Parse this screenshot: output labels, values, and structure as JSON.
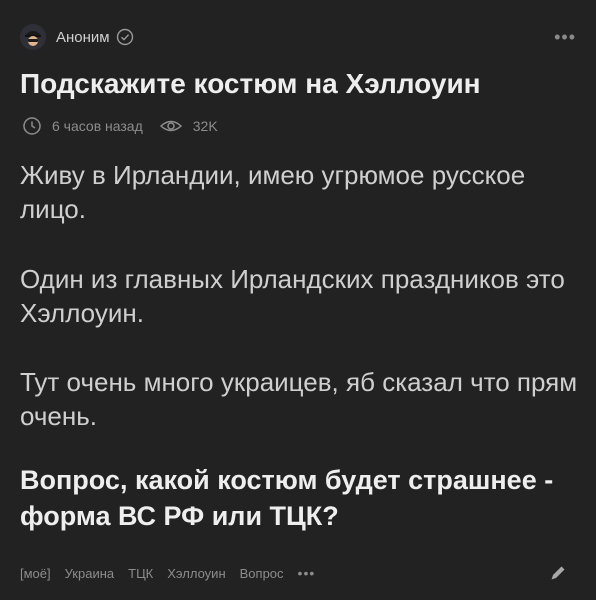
{
  "author": {
    "name": "Аноним",
    "avatar_icon": "anonymous-mask-icon",
    "verified_icon": "check-circle-icon"
  },
  "post": {
    "title": "Подскажите костюм на Хэллоуин",
    "time": "6 часов назад",
    "views": "32K",
    "paragraphs": [
      "Живу в Ирландии, имею угрюмое русское лицо.",
      "Один из главных Ирландских праздников это Хэллоуин.",
      "Тут очень много украицев, яб сказал что прям очень."
    ],
    "question": "Вопрос, какой костюм будет страшнее - форма ВС РФ или ТЦК?"
  },
  "tags": {
    "items": [
      "[моё]",
      "Украина",
      "ТЦК",
      "Хэллоуин",
      "Вопрос"
    ],
    "more": "•••"
  },
  "menu": {
    "more": "•••"
  },
  "colors": {
    "background": "#222222",
    "title": "#eeeeee",
    "body": "#cfcfcf",
    "muted": "#8c8c8c"
  }
}
